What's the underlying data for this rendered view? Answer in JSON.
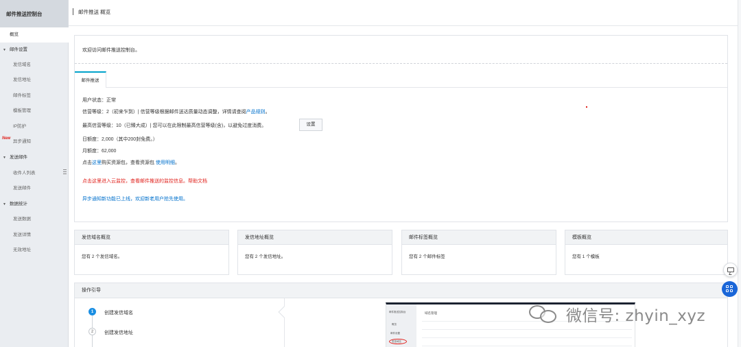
{
  "sidebar": {
    "title": "邮件推送控制台",
    "items": [
      {
        "label": "概览",
        "type": "item",
        "active": true
      },
      {
        "label": "邮件设置",
        "type": "group"
      },
      {
        "label": "发信域名",
        "type": "item"
      },
      {
        "label": "发信地址",
        "type": "item"
      },
      {
        "label": "邮件标签",
        "type": "item"
      },
      {
        "label": "模板管理",
        "type": "item"
      },
      {
        "label": "IP防护",
        "type": "item"
      },
      {
        "label": "异步通知",
        "type": "item",
        "badge": "New"
      },
      {
        "label": "发送邮件",
        "type": "group"
      },
      {
        "label": "收件人列表",
        "type": "item"
      },
      {
        "label": "发送邮件",
        "type": "item"
      },
      {
        "label": "数据统计",
        "type": "group"
      },
      {
        "label": "发送数据",
        "type": "item"
      },
      {
        "label": "发送详情",
        "type": "item"
      },
      {
        "label": "无效地址",
        "type": "item"
      }
    ]
  },
  "header": {
    "title": "邮件推送 概览"
  },
  "panel": {
    "welcome": "欢迎访问邮件推送控制台。",
    "tab": "邮件推送",
    "user_status": "用户状态：正常",
    "credit_prefix": "信营等级：2（初来乍到）| 信营等级根据邮件送达质量动态调整，详情请查阅",
    "credit_link": "产品规则",
    "credit_suffix": "。",
    "max_credit": "最高信营等级：10（已臻大成）| 您可以在此限制最高信营等级(含)，以避免过度消费。",
    "set_button": "设置",
    "daily_quota": "日额度：2,000（其中200封免费。）",
    "monthly_quota": "月额度：62,000",
    "buy_prefix": "点击",
    "buy_link": "这里",
    "buy_middle": "购买资源包，查看资源包",
    "buy_link2": "使用明细",
    "buy_suffix": "。",
    "red_notice": "点击这里进入云监控，查看邮件推送的监控信息。帮助文档",
    "blue_notice": "异步通知新功能已上线，欢迎新老用户抢先使用。"
  },
  "cards": [
    {
      "title": "发信域名概览",
      "body": "您有  2  个发信域名。"
    },
    {
      "title": "发信地址概览",
      "body": "您有  2  个发信地址。"
    },
    {
      "title": "邮件标签概览",
      "body": "您有  2  个邮件标签"
    },
    {
      "title": "模板概览",
      "body": "您有  1  个模板"
    }
  ],
  "guide": {
    "title": "操作引导",
    "steps": [
      {
        "num": "1",
        "label": "创建发信域名",
        "active": true
      },
      {
        "num": "2",
        "label": "创建发信地址",
        "active": false
      }
    ],
    "preview": {
      "sidebar_title": "邮件推送控制台",
      "sidebar_item1": "概览",
      "sidebar_group": "邮件设置",
      "sidebar_highlight": "发信域名",
      "header": "域名管理"
    }
  },
  "watermark": "微信号: zhyin_xyz",
  "icons": {
    "chat": "chat-bubble-icon",
    "apps": "apps-grid-icon",
    "collapse": "menu-handle-icon",
    "wechat": "wechat-logo-icon"
  },
  "colors": {
    "accent": "#00a2ca",
    "link": "#0070cc",
    "alert": "#e0201b",
    "step_active": "#1a8fe3",
    "float_button": "#1a66d8"
  }
}
